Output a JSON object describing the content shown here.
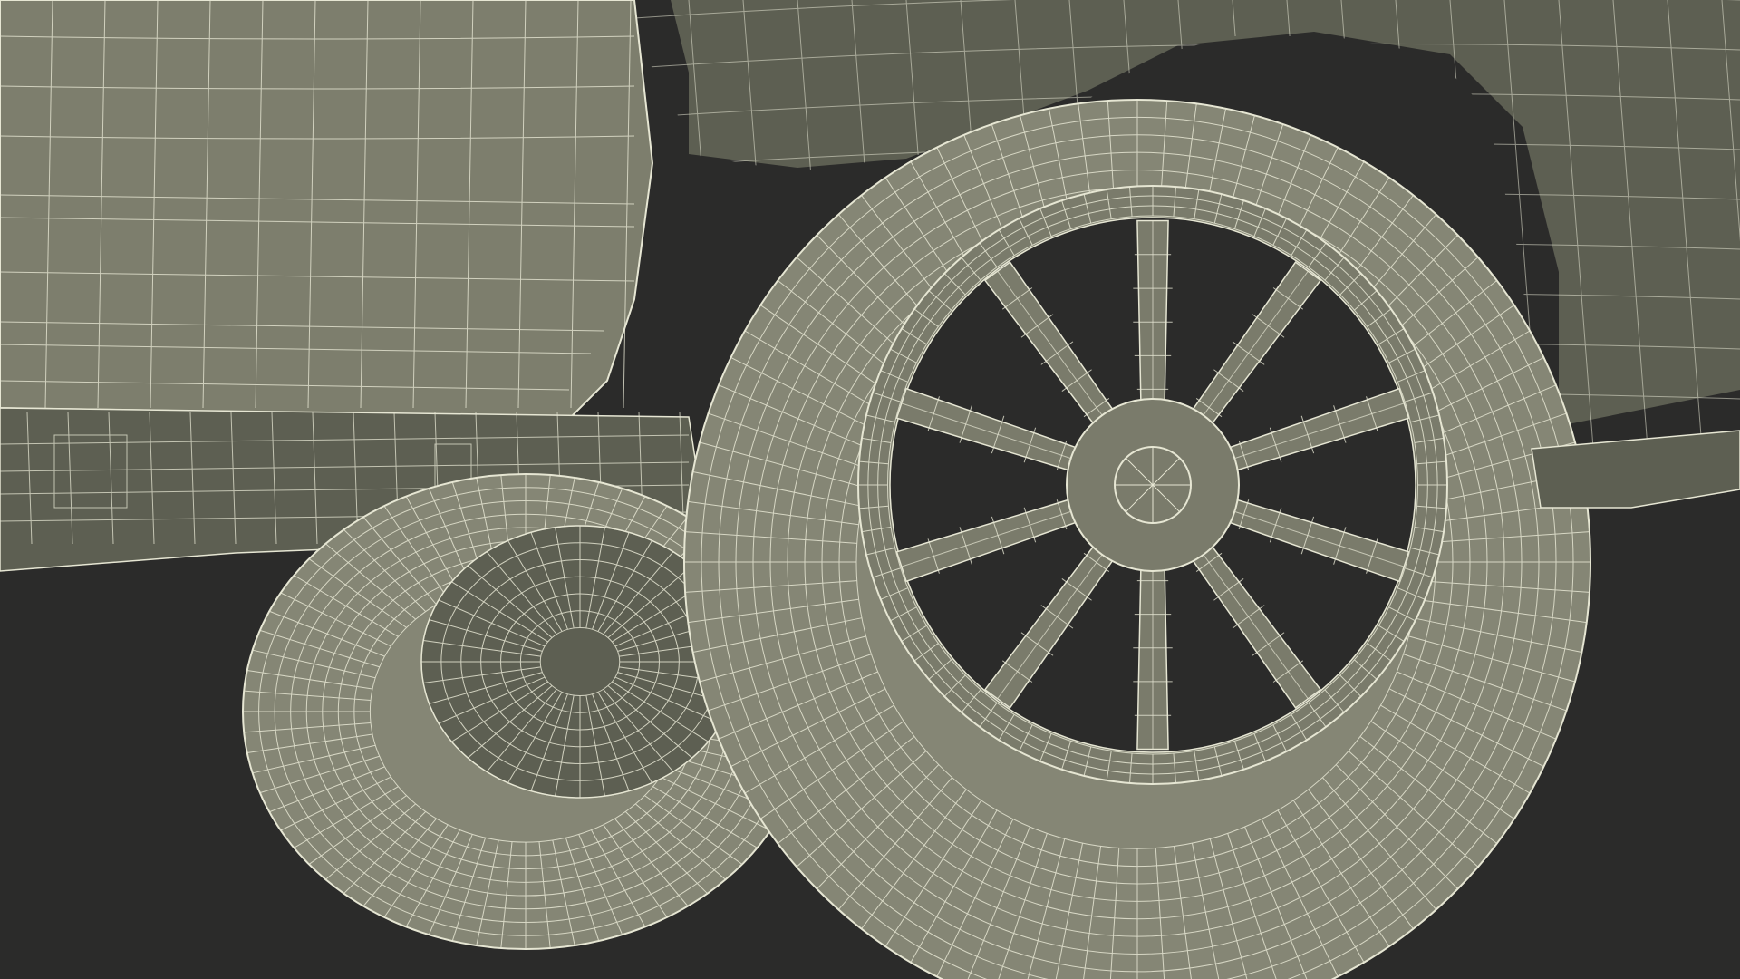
{
  "scene": {
    "background_color": "#2b2b2a",
    "body_color": "#7d7e6d",
    "body_shadow_color": "#5d5f52",
    "tire_color": "#858675",
    "rim_color": "#7a7b6b",
    "wire_color": "#e6e6d3"
  }
}
